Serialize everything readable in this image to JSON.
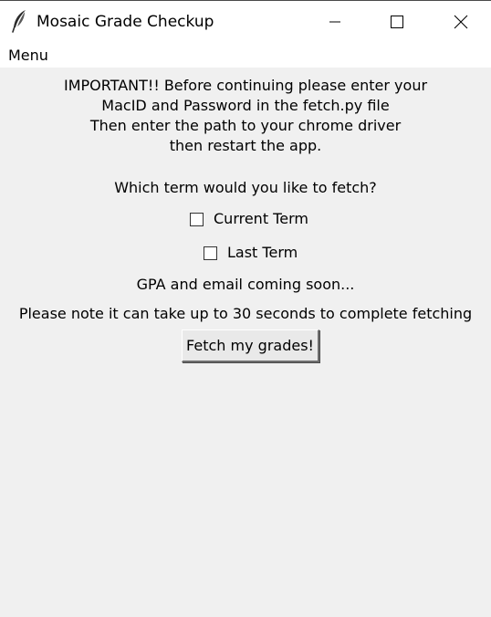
{
  "window": {
    "title": "Mosaic Grade Checkup",
    "app_icon": "feather-icon",
    "controls": {
      "minimize_icon": "minimize-icon",
      "maximize_icon": "maximize-icon",
      "close_icon": "close-icon"
    }
  },
  "menubar": {
    "items": [
      {
        "label": "Menu"
      }
    ]
  },
  "main": {
    "notice_lines": [
      "IMPORTANT!! Before continuing please enter your",
      "MacID and Password in the fetch.py file",
      "Then enter the path to your chrome driver",
      "then restart the app."
    ],
    "question": "Which term would you like to fetch?",
    "options": [
      {
        "label": "Current Term",
        "checked": false
      },
      {
        "label": "Last Term",
        "checked": false
      }
    ],
    "coming_soon": "GPA and email coming soon...",
    "note": "Please note it can take up to 30 seconds to complete fetching",
    "fetch_button_label": "Fetch my grades!"
  },
  "colors": {
    "window_background": "#f0f0f0",
    "titlebar_background": "#ffffff",
    "text": "#000000"
  }
}
